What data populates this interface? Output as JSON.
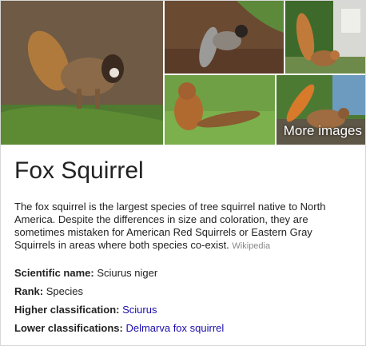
{
  "gallery": {
    "more_label": "More images",
    "images": [
      {
        "subject": "fox squirrel on pine needle ground"
      },
      {
        "subject": "fox squirrel on mulch"
      },
      {
        "subject": "fox squirrel tail up near house"
      },
      {
        "subject": "fox squirrel sitting on lawn"
      },
      {
        "subject": "fox squirrel with raised tail"
      }
    ]
  },
  "title": "Fox Squirrel",
  "description": "The fox squirrel is the largest species of tree squirrel native to North America. Despite the differences in size and coloration, they are sometimes mistaken for American Red Squirrels or Eastern Gray Squirrels in areas where both species co-exist.",
  "source": "Wikipedia",
  "facts": [
    {
      "label": "Scientific name:",
      "value": "Sciurus niger",
      "link": false
    },
    {
      "label": "Rank:",
      "value": "Species",
      "link": false
    },
    {
      "label": "Higher classification:",
      "value": "Sciurus",
      "link": true
    },
    {
      "label": "Lower classifications:",
      "value": "Delmarva fox squirrel",
      "link": true
    }
  ],
  "colors": {
    "link": "#1a0dab",
    "text": "#222222",
    "source": "#878787"
  }
}
